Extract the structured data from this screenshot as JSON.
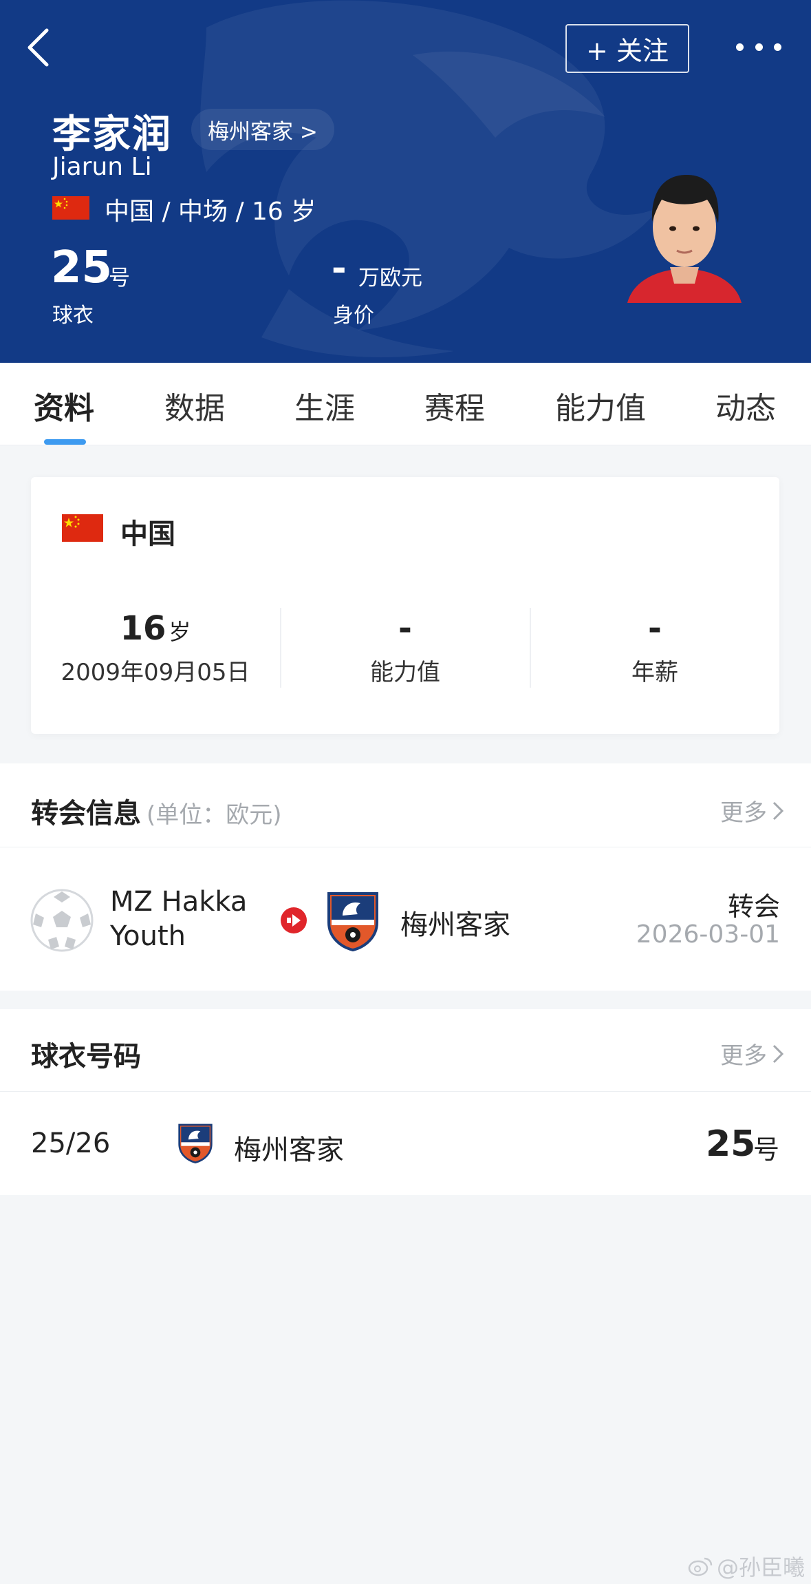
{
  "header": {
    "follow_label": "+ 关注",
    "player_name": "李家润",
    "club_link": "梅州客家 >",
    "name_en": "Jiarun Li",
    "meta": "中国 / 中场 / 16 岁",
    "shirt_number": "25",
    "shirt_unit": "号",
    "shirt_caption": "球衣",
    "market_value": "-",
    "market_value_unit": "万欧元",
    "market_value_caption": "身价"
  },
  "tabs": [
    "资料",
    "数据",
    "生涯",
    "赛程",
    "能力值",
    "动态"
  ],
  "info_card": {
    "country": "中国",
    "age_value": "16",
    "age_unit": "岁",
    "birthdate": "2009年09月05日",
    "ability_value": "-",
    "ability_label": "能力值",
    "salary_value": "-",
    "salary_label": "年薪"
  },
  "transfer": {
    "title": "转会信息",
    "subtitle": "(单位：欧元)",
    "more_label": "更多",
    "from_club_line1": "MZ Hakka",
    "from_club_line2": "Youth",
    "to_club": "梅州客家",
    "type": "转会",
    "date": "2026-03-01"
  },
  "jersey": {
    "title": "球衣号码",
    "more_label": "更多",
    "season": "25/26",
    "club": "梅州客家",
    "number": "25",
    "unit": "号"
  },
  "watermark": "@孙臣曦",
  "colors": {
    "header_bg": "#123a86",
    "accent_blue": "#3d9af0",
    "transfer_arrow": "#e0262b",
    "flag_red": "#de2910",
    "flag_yellow": "#ffde00"
  }
}
